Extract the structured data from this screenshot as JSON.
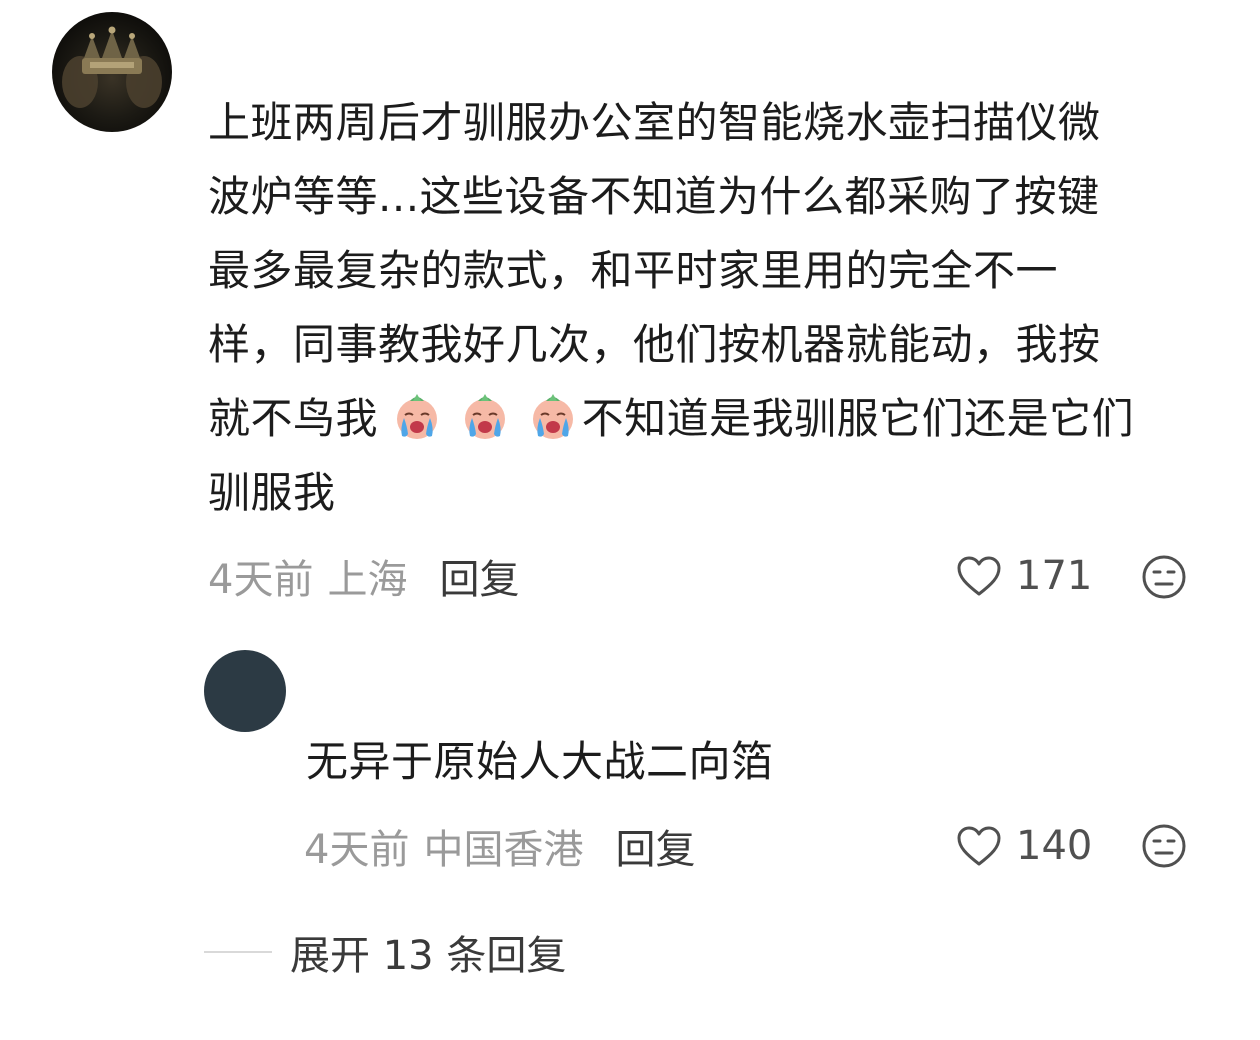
{
  "comment": {
    "lines": [
      "上班两周后才驯服办公室的智能烧水壶扫描仪微",
      "波炉等等...这些设备不知道为什么都采购了按键",
      "最多最复杂的款式，和平时家里用的完全不一",
      "样，同事教我好几次，他们按机器就能动，我按"
    ],
    "line5_before": "就不鸟我",
    "emoji_name": "crying-face-icon",
    "line5_after": "不知道是我驯服它们还是它们",
    "line6": "驯服我",
    "time": "4天前",
    "location": "上海",
    "reply_label": "回复",
    "likes": "171"
  },
  "reply": {
    "text": "无异于原始人大战二向箔",
    "time": "4天前",
    "location": "中国香港",
    "reply_label": "回复",
    "likes": "140"
  },
  "expand": {
    "label": "展开 13 条回复"
  },
  "colors": {
    "text": "#1c1c1c",
    "meta": "#9a9a9a",
    "reply_avatar": "#2c3a44"
  }
}
